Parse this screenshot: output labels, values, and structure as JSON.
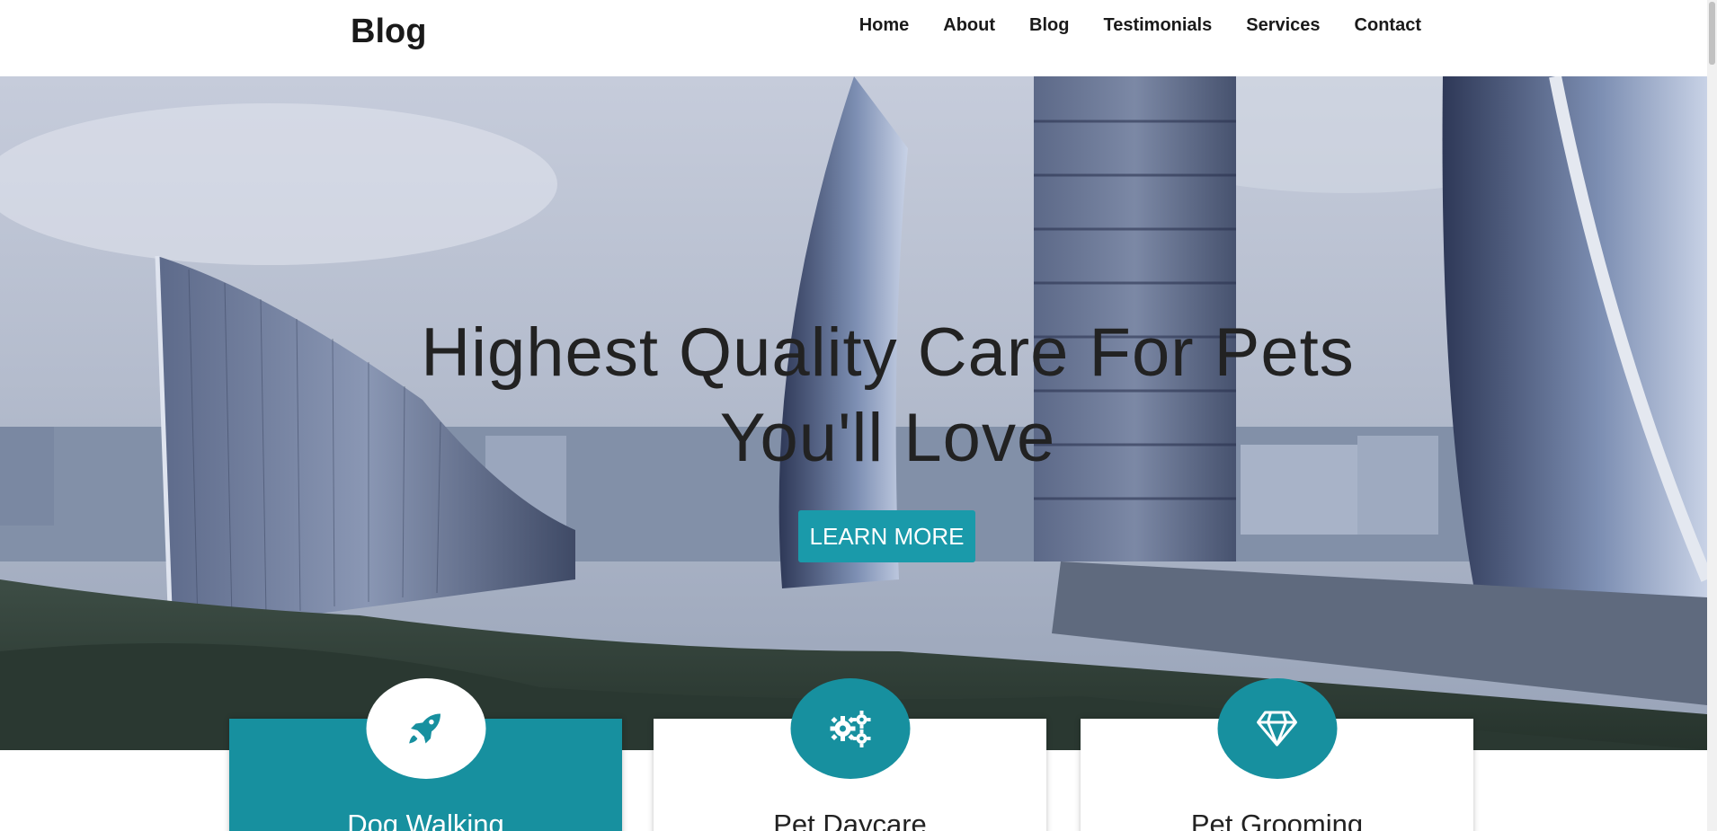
{
  "brand": "Blog",
  "nav": [
    "Home",
    "About",
    "Blog",
    "Testimonials",
    "Services",
    "Contact"
  ],
  "hero": {
    "title_line1": "Highest Quality Care For Pets",
    "title_line2": "You'll Love",
    "button": "LEARN MORE"
  },
  "services": [
    {
      "title": "Dog Walking",
      "icon": "rocket-icon",
      "active": true
    },
    {
      "title": "Pet Daycare",
      "icon": "gears-icon",
      "active": false
    },
    {
      "title": "Pet Grooming",
      "icon": "diamond-icon",
      "active": false
    }
  ],
  "colors": {
    "accent": "#17909f",
    "button": "#1a9aaa"
  }
}
